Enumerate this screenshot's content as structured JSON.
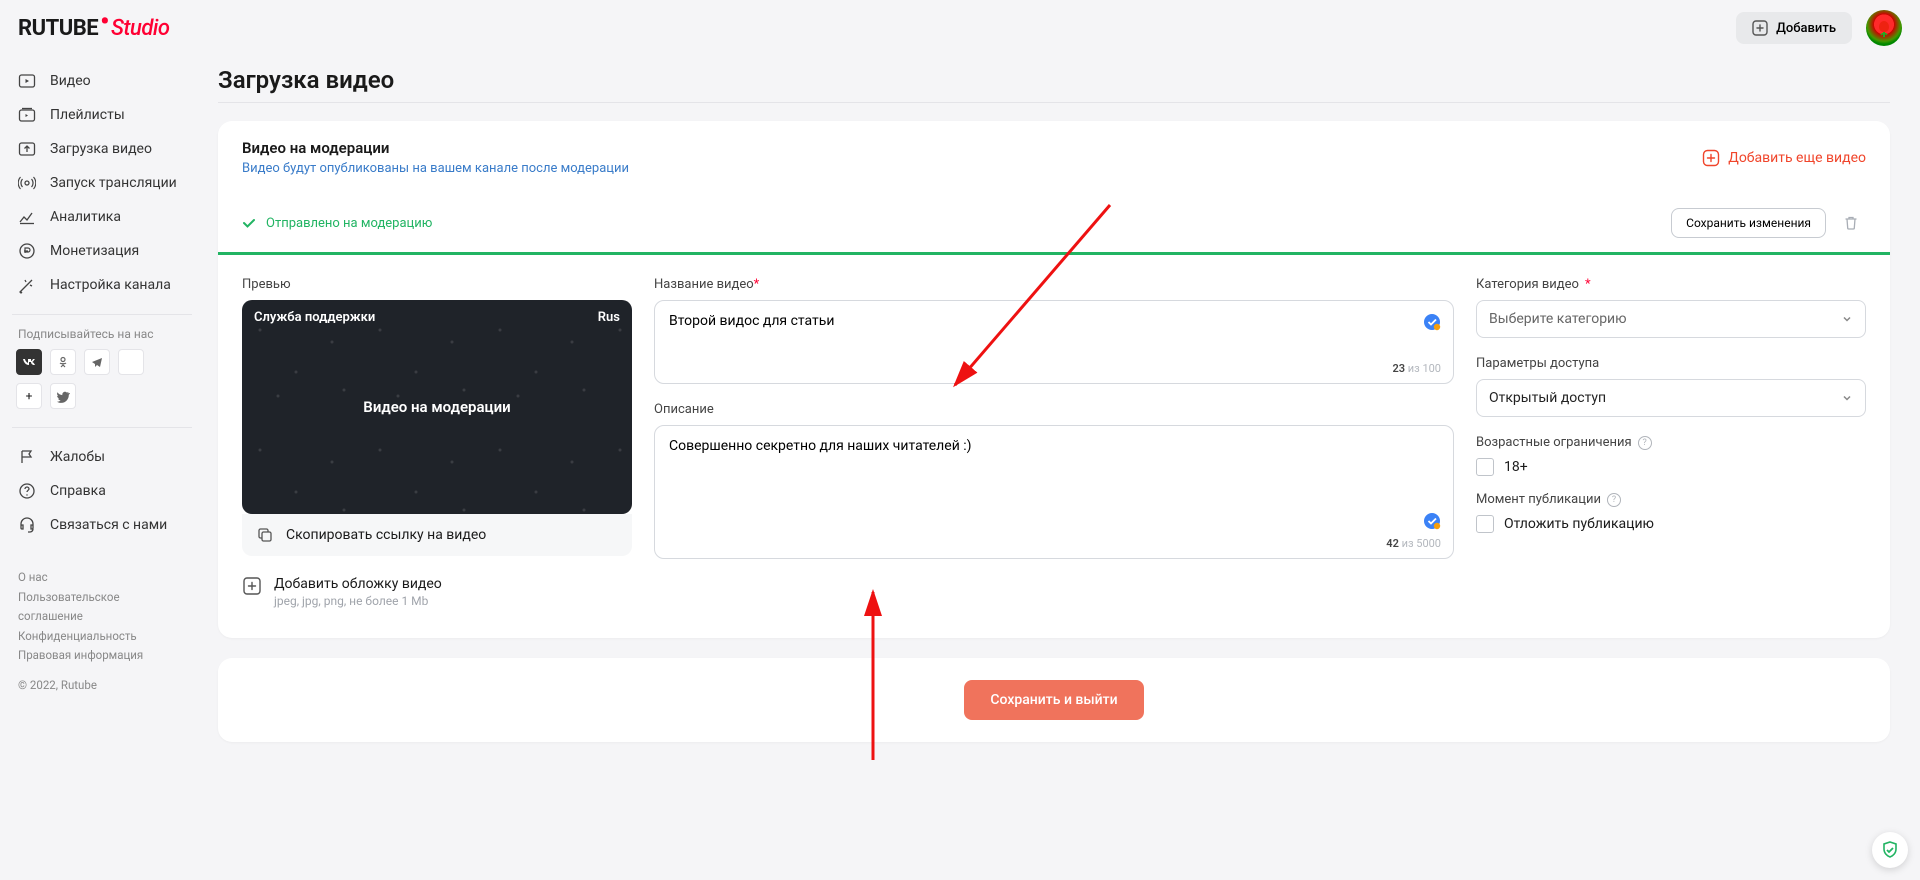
{
  "logo": {
    "brand": "RUTUBE",
    "studio": "Studio"
  },
  "topbar": {
    "add": "Добавить"
  },
  "sidebar": {
    "items": [
      {
        "id": "video",
        "label": "Видео"
      },
      {
        "id": "playlists",
        "label": "Плейлисты"
      },
      {
        "id": "upload",
        "label": "Загрузка видео"
      },
      {
        "id": "stream",
        "label": "Запуск трансляции"
      },
      {
        "id": "analytics",
        "label": "Аналитика"
      },
      {
        "id": "monetization",
        "label": "Монетизация"
      },
      {
        "id": "settings",
        "label": "Настройка канала"
      }
    ],
    "subscribe": "Подписывайтесь на нас",
    "bottom": [
      {
        "id": "complaints",
        "label": "Жалобы"
      },
      {
        "id": "help",
        "label": "Справка"
      },
      {
        "id": "contact",
        "label": "Связаться с нами"
      }
    ],
    "footer": {
      "about": "О нас",
      "terms": "Пользовательское соглашение",
      "privacy": "Конфиденциальность",
      "legal": "Правовая информация",
      "copyright": "© 2022, Rutube"
    }
  },
  "page": {
    "title": "Загрузка видео"
  },
  "moderation": {
    "heading": "Видео на модерации",
    "sub": "Видео будут опубликованы на вашем канале после модерации",
    "add_more": "Добавить еще видео",
    "status": "Отправлено на модерацию",
    "save_changes": "Сохранить изменения"
  },
  "preview": {
    "label": "Превью",
    "support": "Служба поддержки",
    "lang": "Rus",
    "overlay": "Видео на модерации",
    "copy_link": "Скопировать ссылку на видео",
    "add_cover": "Добавить обложку видео",
    "cover_hint": "jpeg, jpg, png, не более 1 Mb"
  },
  "fields": {
    "title_label": "Название видео",
    "title_value": "Второй видос для статьи",
    "title_count": "23",
    "title_max": "из 100",
    "desc_label": "Описание",
    "desc_value": "Совершенно секретно для наших читателей :)",
    "desc_count": "42",
    "desc_max": "из 5000"
  },
  "settings": {
    "category_label": "Категория видео",
    "category_placeholder": "Выберите категорию",
    "access_label": "Параметры доступа",
    "access_value": "Открытый доступ",
    "age_label": "Возрастные ограничения",
    "age_18": "18+",
    "publish_label": "Момент публикации",
    "postpone": "Отложить публикацию"
  },
  "save_exit": "Сохранить и выйти"
}
